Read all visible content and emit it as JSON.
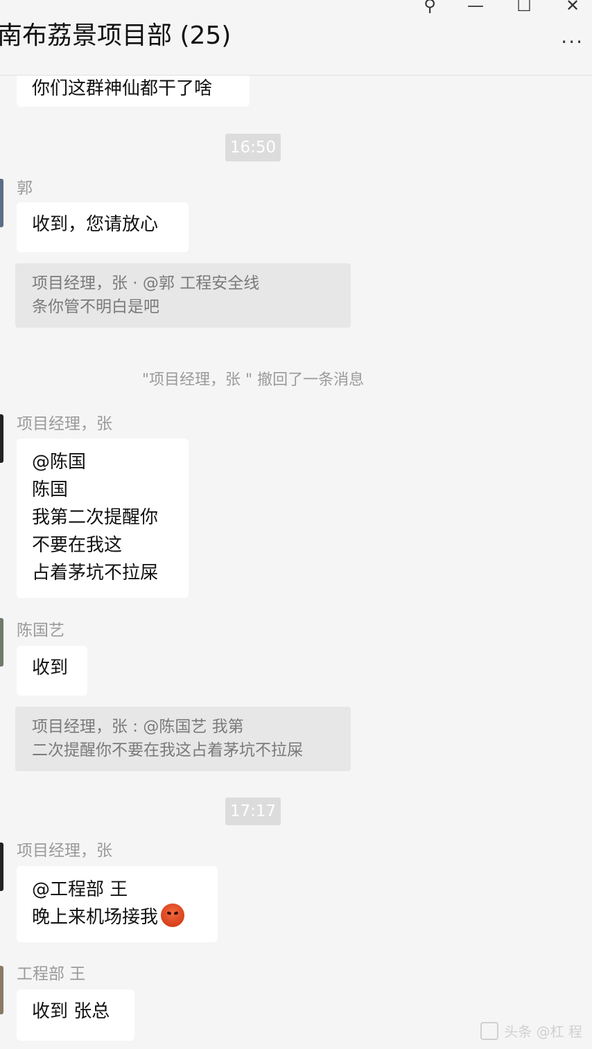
{
  "window": {
    "title": "南布荔景项目部 (25)",
    "pin_glyph": "⚲",
    "minimize_glyph": "—",
    "maximize_glyph": "☐",
    "close_glyph": "✕",
    "more_glyph": "···"
  },
  "messages": {
    "top_partial": "你们这群神仙都干了啥",
    "time_1": "16:50",
    "sender_1": "郭",
    "msg_1": "收到，您请放心",
    "quote_1": [
      "项目经理，张  · @郭    工程安全线",
      "条你管不明白是吧"
    ],
    "system_recall": "\"项目经理，张  \" 撤回了一条消息",
    "sender_2": "项目经理，张",
    "msg_2": [
      "@陈国",
      "陈国",
      "我第二次提醒你",
      "不要在我这",
      "占着茅坑不拉屎"
    ],
    "sender_3": "陈国艺",
    "msg_3": "收到",
    "quote_2": [
      "项目经理，张  : @陈国艺   我第",
      "二次提醒你不要在我这占着茅坑不拉屎"
    ],
    "time_2": "17:17",
    "sender_4": "项目经理，张",
    "msg_4": [
      "@工程部 王",
      "晚上来机场接我"
    ],
    "emoji_name": "angry-face",
    "sender_5": "工程部 王",
    "msg_5": "收到 张总"
  },
  "watermark": "头条 @杠 程",
  "colors": {
    "background": "#f5f5f5",
    "bubble": "#ffffff",
    "quote": "#e7e7e7",
    "time_badge": "#dcdcdc"
  }
}
